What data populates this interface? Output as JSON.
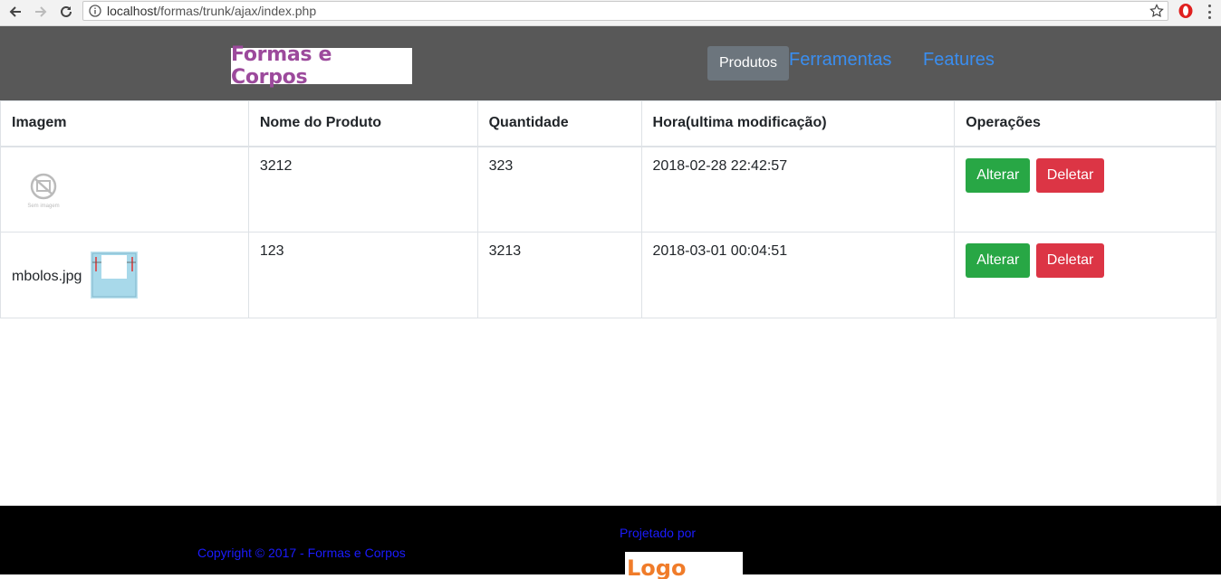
{
  "browser": {
    "url_host": "localhost",
    "url_path": "/formas/trunk/ajax/index.php"
  },
  "header": {
    "logo_text": "Formas e Corpos",
    "nav": {
      "active": "Produtos",
      "links": [
        "Ferramentas",
        "Features"
      ]
    }
  },
  "table": {
    "headers": [
      "Imagem",
      "Nome do Produto",
      "Quantidade",
      "Hora(ultima modificação)",
      "Operações"
    ],
    "rows": [
      {
        "image_caption": "Sem imagem",
        "filename": "",
        "name": "3212",
        "quantity": "323",
        "time": "2018-02-28 22:42:57"
      },
      {
        "image_caption": "",
        "filename": "mbolos.jpg",
        "name": "123",
        "quantity": "3213",
        "time": "2018-03-01 00:04:51"
      }
    ],
    "buttons": {
      "edit": "Alterar",
      "delete": "Deletar"
    }
  },
  "footer": {
    "copyright": "Copyright © 2017 - Formas e Corpos",
    "designed_by": "Projetado por",
    "designer_logo": "Logo Serra"
  },
  "colors": {
    "header_bg": "#585858",
    "nav_link": "#3a8ef0",
    "btn_edit": "#28a745",
    "btn_delete": "#dc3545",
    "footer_link": "#1b1bff"
  }
}
